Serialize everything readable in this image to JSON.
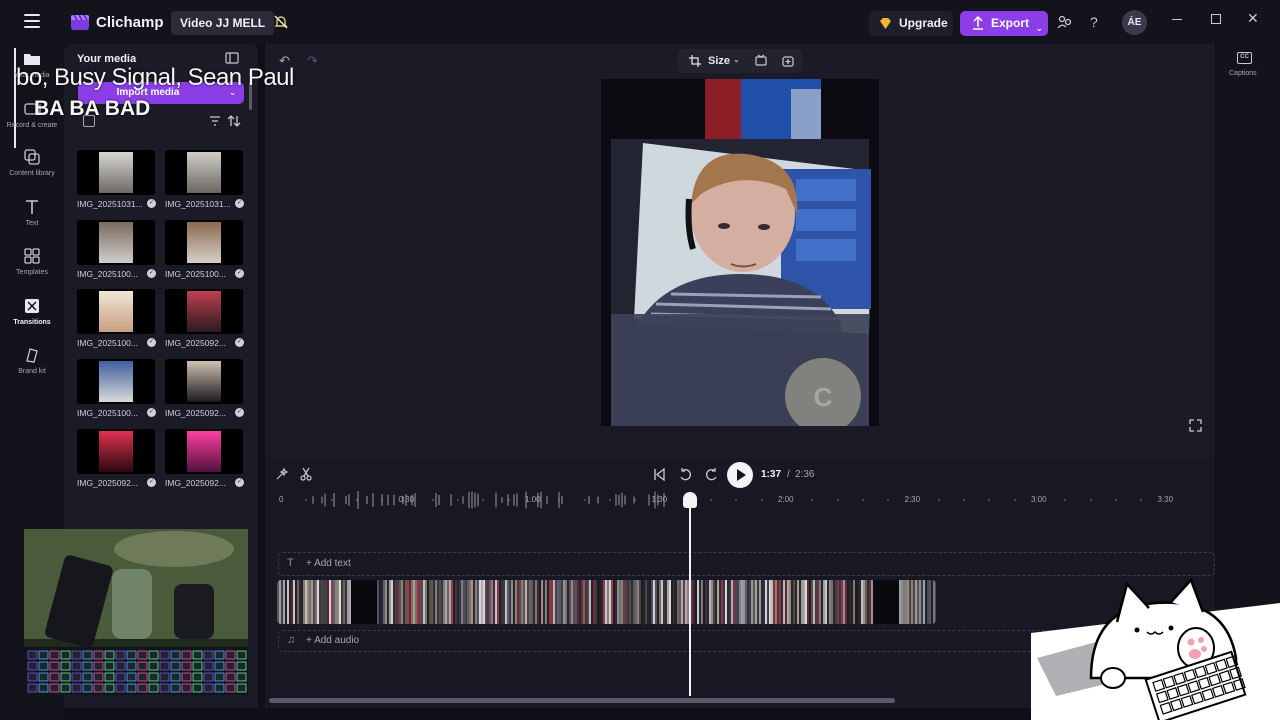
{
  "app": {
    "name": "Clichamp",
    "project_name": "Video JJ MELL",
    "upgrade_label": "Upgrade",
    "export_label": "Export",
    "avatar_initials": "ÁE",
    "accent_color": "#8b3de8"
  },
  "leftnav": {
    "items": [
      {
        "label": "Your media",
        "icon": "folder-icon"
      },
      {
        "label": "Record & create",
        "icon": "camera-icon"
      },
      {
        "label": "Content library",
        "icon": "library-icon"
      },
      {
        "label": "Text",
        "icon": "text-icon"
      },
      {
        "label": "Templates",
        "icon": "templates-icon"
      },
      {
        "label": "Transitions",
        "icon": "transitions-icon"
      },
      {
        "label": "Brand kit",
        "icon": "brand-icon"
      }
    ]
  },
  "media": {
    "title": "Your media",
    "import_label": "Import media",
    "items": [
      {
        "name": "IMG_20251031..."
      },
      {
        "name": "IMG_20251031..."
      },
      {
        "name": "IMG_2025100..."
      },
      {
        "name": "IMG_2025100..."
      },
      {
        "name": "IMG_2025100..."
      },
      {
        "name": "IMG_2025092..."
      },
      {
        "name": "IMG_2025100..."
      },
      {
        "name": "IMG_2025092..."
      },
      {
        "name": "IMG_2025092..."
      },
      {
        "name": "IMG_2025092..."
      }
    ]
  },
  "preview": {
    "size_label": "Size",
    "watermark_letter": "C"
  },
  "captions": {
    "label": "Captions"
  },
  "timeline": {
    "current_time": "1:37",
    "separator": "/",
    "total_time": "2:36",
    "ruler_labels": [
      "0",
      "0:30",
      "1:00",
      "1:30",
      "2:00",
      "2:30",
      "3:00",
      "3:30"
    ],
    "add_text_label": "+ Add text",
    "add_audio_label": "+ Add audio"
  },
  "overlay": {
    "lyric_line_1": "bo, Busy Signal, Sean Paul",
    "lyric_line_2": "BA BA BAD"
  }
}
